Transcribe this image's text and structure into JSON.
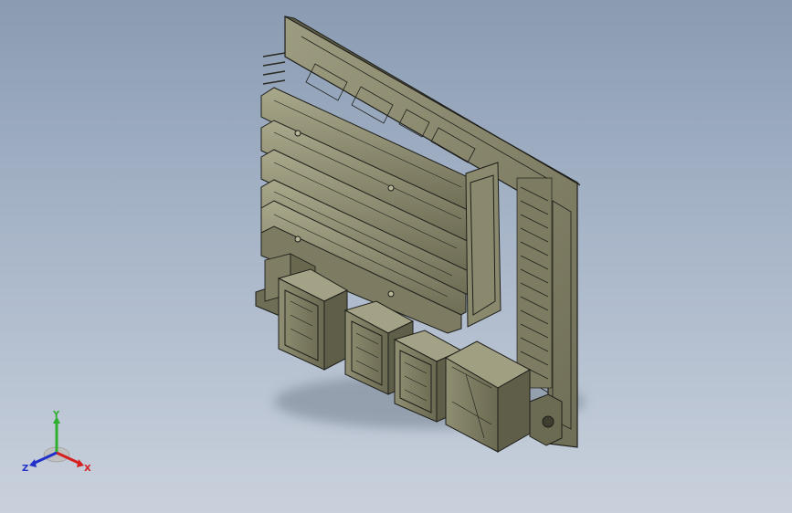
{
  "viewport": {
    "background_top": "#8a9bb2",
    "background_bottom": "#c9d1dc"
  },
  "model": {
    "body_color": "#8b8a6e",
    "edge_color": "#1e1e1a",
    "highlight_color": "#b8b79a"
  },
  "triad": {
    "x_label": "X",
    "y_label": "Y",
    "z_label": "Z",
    "x_color": "#d42020",
    "y_color": "#2fae2f",
    "z_color": "#2030c8"
  }
}
